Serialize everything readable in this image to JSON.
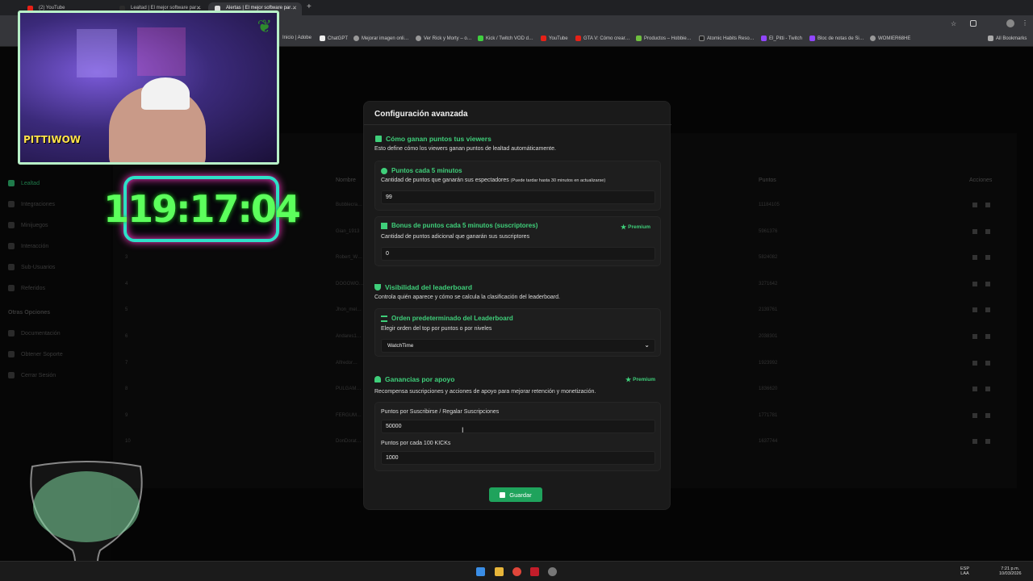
{
  "browser": {
    "tabs": [
      {
        "label": "(2) YouTube",
        "active": false
      },
      {
        "label": "Lealtad | El mejor software par…",
        "active": false
      },
      {
        "label": "Alertas | El mejor software par…",
        "active": true
      }
    ],
    "new_tab": "+",
    "bookmarks": [
      "Inicio | Adobe",
      "ChatGPT",
      "Mejorar imagen onli…",
      "Ver Rick y Morty – o…",
      "Kick / Twitch VOD d…",
      "YouTube",
      "GTA V: Cómo crear…",
      "Productos – Hobbie…",
      "Atomic Habits Reso…",
      "El_Pitti - Twitch",
      "Bloc de notas de Si…",
      "WOMIER68HE"
    ],
    "all_bookmarks": "All Bookmarks"
  },
  "sidebar": {
    "items": [
      "Lealtad",
      "Integraciones",
      "Minijuegos",
      "Interacción",
      "Sub-Usuarios",
      "Referidos"
    ],
    "section": "Otras Opciones",
    "other_items": [
      "Documentación",
      "Obtener Soporte",
      "Cerrar Sesión"
    ]
  },
  "bg_table": {
    "headers": {
      "name": "Nombre",
      "points": "Puntos",
      "actions": "Acciones"
    },
    "rows": [
      {
        "rank": "1",
        "name": "Bubblecra…",
        "points": "11184105"
      },
      {
        "rank": "2",
        "name": "Gian_1913",
        "points": "5961376"
      },
      {
        "rank": "3",
        "name": "Robert_W…",
        "points": "5824082"
      },
      {
        "rank": "4",
        "name": "DOGOWO…",
        "points": "3271642"
      },
      {
        "rank": "5",
        "name": "Jhon_mel…",
        "points": "2139761"
      },
      {
        "rank": "6",
        "name": "Andares1…",
        "points": "2038301"
      },
      {
        "rank": "7",
        "name": "Alfredor…",
        "points": "1923992"
      },
      {
        "rank": "8",
        "name": "PULGAM…",
        "points": "1836620"
      },
      {
        "rank": "9",
        "name": "FERGUM…",
        "points": "1771781"
      },
      {
        "rank": "10",
        "name": "DonDorat…",
        "points": "1637744"
      }
    ]
  },
  "overlay": {
    "timer": "119:17:04",
    "cam_logo": "PITTIWOW"
  },
  "modal": {
    "title": "Configuración avanzada",
    "section1": {
      "title": "Cómo ganan puntos tus viewers",
      "desc": "Esto define cómo los viewers ganan puntos de lealtad automáticamente.",
      "card1": {
        "title": "Puntos cada 5 minutos",
        "desc": "Cantidad de puntos que ganarán sus espectadores",
        "note": "(Puede tardar hasta 30 minutos en actualizarse)",
        "value": "99"
      },
      "card2": {
        "title": "Bonus de puntos cada 5 minutos (suscriptores)",
        "badge": "Premium",
        "desc": "Cantidad de puntos adicional que ganarán sus suscriptores",
        "value": "0"
      }
    },
    "section2": {
      "title": "Visibilidad del leaderboard",
      "desc": "Controla quién aparece y cómo se calcula la clasificación del leaderboard.",
      "card": {
        "title": "Orden predeterminado del Leaderboard",
        "desc": "Elegir orden del top por puntos o por niveles",
        "selected": "WatchTime"
      }
    },
    "section3": {
      "title": "Ganancias por apoyo",
      "badge": "Premium",
      "desc": "Recompensa suscripciones y acciones de apoyo para mejorar retención y monetización.",
      "field1": {
        "label": "Puntos por Suscribirse / Regalar Suscripciones",
        "value": "50000"
      },
      "field2": {
        "label": "Puntos por cada 100 KICKs",
        "value": "1000"
      }
    },
    "save_label": "Guardar"
  },
  "taskbar": {
    "lang": "ESP",
    "lang2": "LAA",
    "time": "7:21 p.m.",
    "date": "10/03/2026"
  },
  "colors": {
    "accent": "#3fcf7a",
    "button": "#1fa35c",
    "timer_text": "#5cff5c",
    "timer_border": "#2de0c8"
  }
}
